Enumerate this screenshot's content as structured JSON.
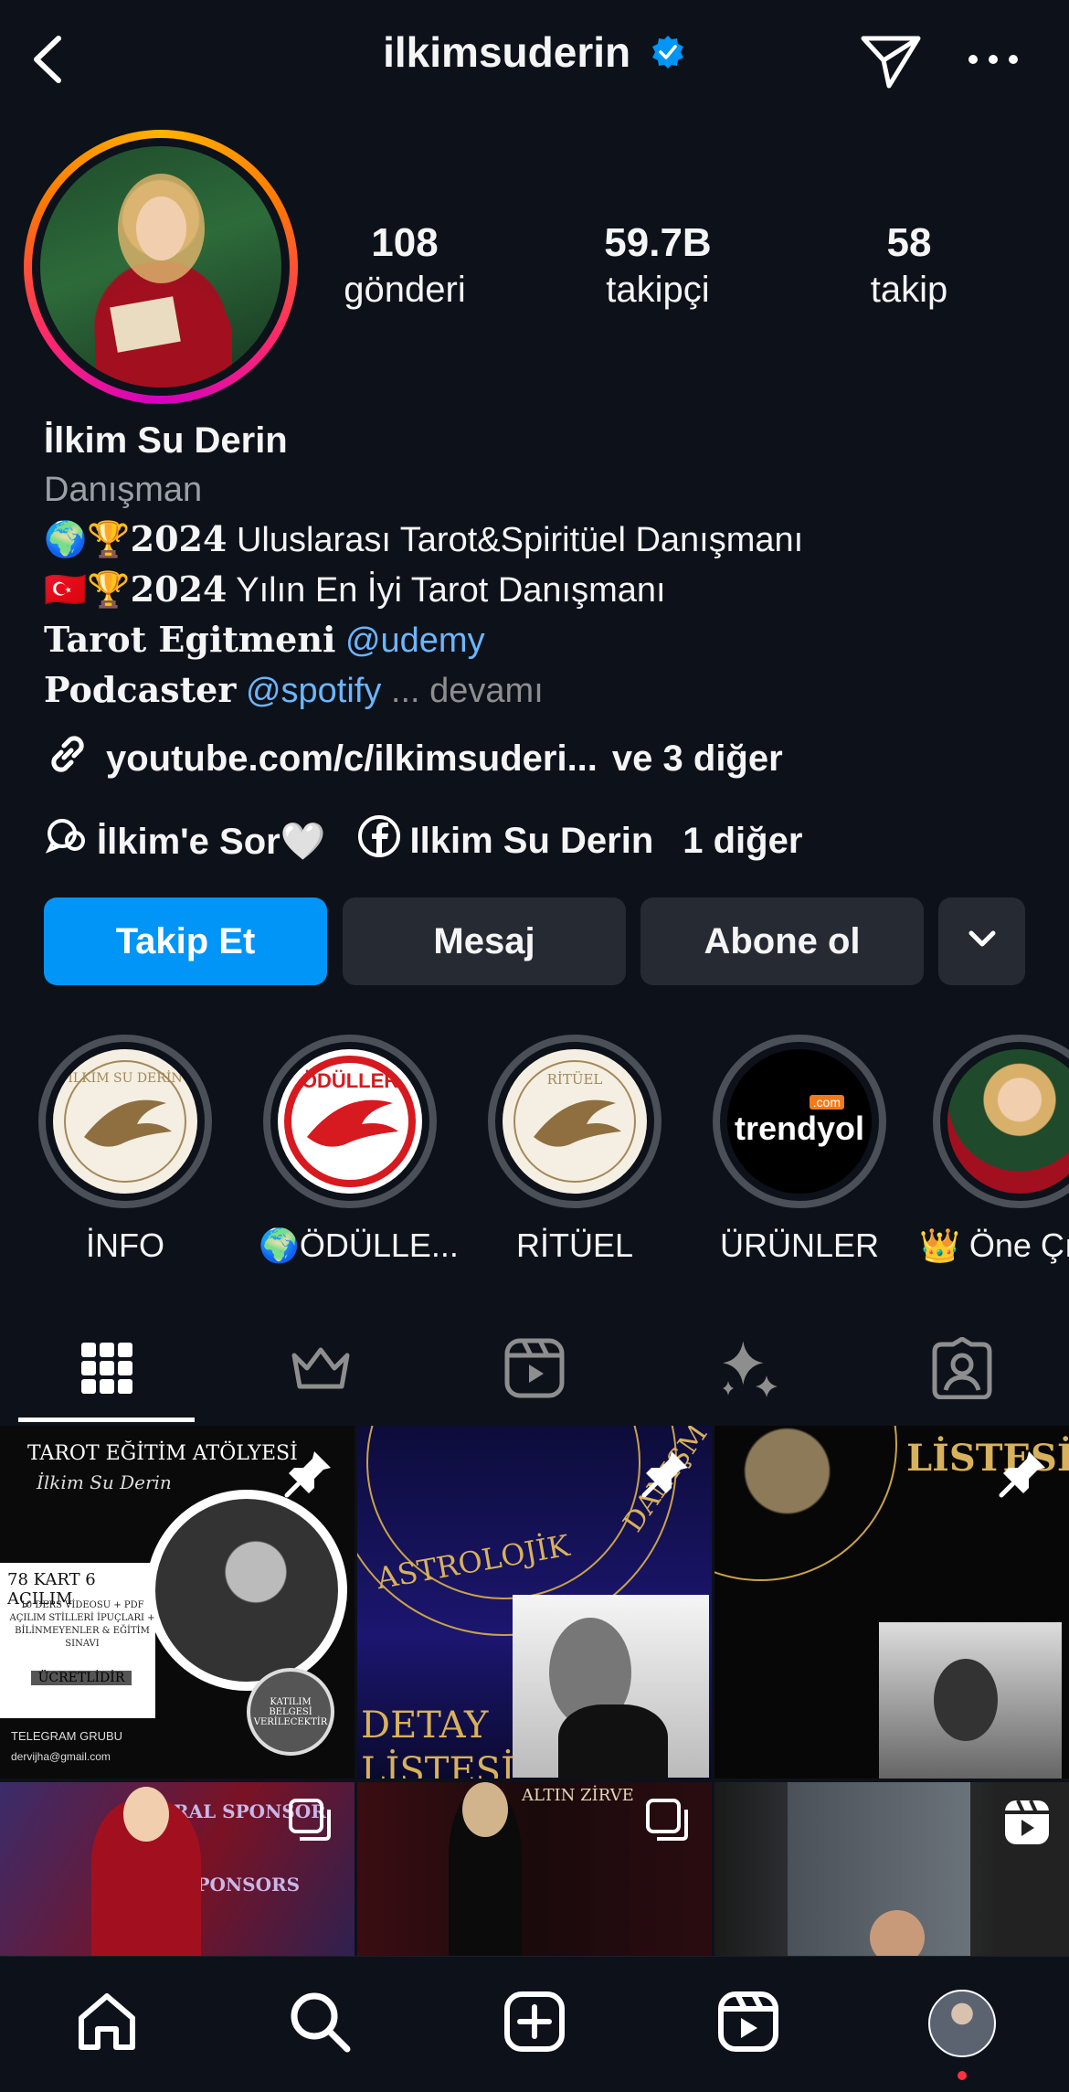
{
  "header": {
    "username": "ilkimsuderin",
    "back_icon": "chevron-left-icon",
    "verified_icon": "verified-badge-icon",
    "send_icon": "paper-plane-icon",
    "more_icon": "more-horizontal-icon"
  },
  "stats": [
    {
      "value": "108",
      "label": "gönderi"
    },
    {
      "value": "59.7B",
      "label": "takipçi"
    },
    {
      "value": "58",
      "label": "takip"
    }
  ],
  "bio": {
    "name": "İlkim Su Derin",
    "category": "Danışman",
    "line1_emoji": "🌍🏆",
    "line1_year": "2024",
    "line1_text": " Uluslarası Tarot&Spiritüel Danışmanı",
    "line2_emoji": "🇹🇷🏆",
    "line2_year": "2024",
    "line2_text": " Yılın En İyi Tarot Danışmanı",
    "line3_bold": "Tarot Egitmeni",
    "line3_mention": "@udemy",
    "line4_bold": "Podcaster",
    "line4_mention": "@spotify",
    "line4_more": "... devamı"
  },
  "links": {
    "url": "youtube.com/c/ilkimsuderi...",
    "others": "ve 3 diğer",
    "thread_label": "İlkim'e Sor🤍",
    "facebook_label": "Ilkim Su Derin",
    "more_label": "1 diğer"
  },
  "actions": {
    "follow": "Takip Et",
    "message": "Mesaj",
    "subscribe": "Abone ol"
  },
  "highlights": [
    {
      "label": "İNFO",
      "cover_text": "İLKİM SU DERİN"
    },
    {
      "label": "🌍ÖDÜLLE...",
      "cover_text": "ÖDÜLLER"
    },
    {
      "label": "RİTÜEL",
      "cover_text": "RİTÜEL"
    },
    {
      "label": "ÜRÜNLER",
      "cover_text": "trendyol",
      "cover_sub": ".com"
    },
    {
      "label": "👑 Öne Çık",
      "cover_text": ""
    }
  ],
  "tabs": [
    {
      "name": "grid-icon"
    },
    {
      "name": "crown-icon"
    },
    {
      "name": "reels-icon"
    },
    {
      "name": "sparkles-icon"
    },
    {
      "name": "tagged-icon"
    }
  ],
  "posts": {
    "p1": {
      "title": "TAROT EĞİTİM ATÖLYESİ",
      "subtitle": "İlkim Su Derin",
      "headline": "78 KART 6 AÇILIM",
      "details": "10 DERS VİDEOSU + PDF AÇILIM STİLLERİ İPUÇLARI + BİLİNMEYENLER & EĞİTİM SINAVI",
      "price": "ÜCRETLİDİR",
      "badge": "KATILIM BELGESİ VERİLECEKTİR",
      "telegram": "TELEGRAM GRUBU",
      "email": "dervijha@gmail.com"
    },
    "p2": {
      "text1": "ASTROLOJİK",
      "text2": "DANIŞM",
      "text3": "DETAY",
      "text4": "LİSTESİ"
    },
    "p3": {
      "text1": "LİSTESİ"
    },
    "p4": {
      "text1": "RAL SPONSOR",
      "text2": "SPONSORS"
    },
    "p5": {
      "text1": "ALTIN ZİRVE"
    },
    "p6": {
      "text1": ""
    }
  },
  "bottom_nav": [
    {
      "name": "home-icon"
    },
    {
      "name": "search-icon"
    },
    {
      "name": "create-icon"
    },
    {
      "name": "reels-nav-icon"
    },
    {
      "name": "profile-avatar"
    }
  ],
  "colors": {
    "background": "#0d111a",
    "primary_button": "#0095f6",
    "secondary_button": "#262a33",
    "mention": "#6cb6ff",
    "verified": "#0095f6"
  }
}
